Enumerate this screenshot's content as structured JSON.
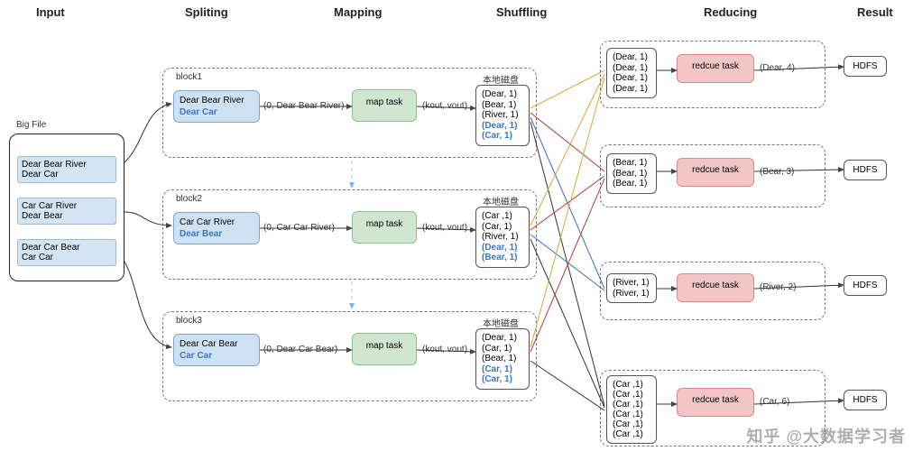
{
  "stages": {
    "input": "Input",
    "splitting": "Spliting",
    "mapping": "Mapping",
    "shuffling": "Shuffling",
    "reducing": "Reducing",
    "result": "Result"
  },
  "input": {
    "title": "Big File",
    "items": [
      "Dear Bear River\nDear Car",
      "Car Car River\nDear Bear",
      "Dear Car Bear\nCar Car"
    ]
  },
  "blocks": [
    {
      "name": "block1",
      "split_line1": "Dear Bear River",
      "split_line2": "Dear Car",
      "map_in": "(0, Dear Bear River)",
      "map_task": "map task",
      "map_out_label": "(kout, vout)",
      "disk_label": "本地磁盘",
      "disk_lines": [
        "(Dear, 1)",
        "(Bear, 1)",
        "(River, 1)"
      ],
      "disk_blue": [
        "(Dear, 1)",
        "(Car, 1)"
      ]
    },
    {
      "name": "block2",
      "split_line1": "Car Car River",
      "split_line2": "Dear Bear",
      "map_in": "(0, Car Car River)",
      "map_task": "map task",
      "map_out_label": "(kout, vout)",
      "disk_label": "本地磁盘",
      "disk_lines": [
        "(Car ,1)",
        "(Car, 1)",
        "(River, 1)"
      ],
      "disk_blue": [
        "(Dear, 1)",
        "(Bear, 1)"
      ]
    },
    {
      "name": "block3",
      "split_line1": "Dear Car Bear",
      "split_line2": "Car Car",
      "map_in": "(0, Dear Car Bear)",
      "map_task": "map task",
      "map_out_label": "(kout, vout)",
      "disk_label": "本地磁盘",
      "disk_lines": [
        "(Dear, 1)",
        "(Car, 1)",
        "(Bear, 1)"
      ],
      "disk_blue": [
        "(Car, 1)",
        "(Car, 1)"
      ]
    }
  ],
  "reduces": [
    {
      "group": [
        "(Dear, 1)",
        "(Dear, 1)",
        "(Dear, 1)",
        "(Dear, 1)"
      ],
      "task": "redcue task",
      "out": "(Dear, 4)",
      "hdfs": "HDFS"
    },
    {
      "group": [
        "(Bear, 1)",
        "(Bear, 1)",
        "(Bear, 1)"
      ],
      "task": "redcue task",
      "out": "(Bear, 3)",
      "hdfs": "HDFS"
    },
    {
      "group": [
        "(River, 1)",
        "(River, 1)"
      ],
      "task": "redcue task",
      "out": "(River, 2)",
      "hdfs": "HDFS"
    },
    {
      "group": [
        "(Car ,1)",
        "(Car ,1)",
        "(Car ,1)",
        "(Car ,1)",
        "(Car ,1)",
        "(Car ,1)"
      ],
      "task": "redcue task",
      "out": "(Car, 6)",
      "hdfs": "HDFS"
    }
  ],
  "watermark": "知乎 @大数据学习者"
}
